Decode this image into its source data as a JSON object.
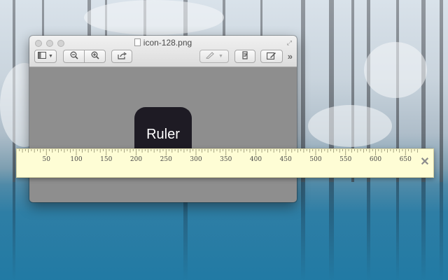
{
  "window": {
    "title": "icon-128.png"
  },
  "toolbar": {
    "icons": [
      "sidebar-view-icon",
      "chevron-down-icon",
      "zoom-out-icon",
      "zoom-in-icon",
      "share-icon",
      "markup-pen-icon",
      "rotate-icon",
      "edit-icon",
      "more-icon"
    ]
  },
  "content": {
    "icon_label": "Ruler"
  },
  "ruler": {
    "ticks": [
      50,
      100,
      150,
      200,
      250,
      300,
      350,
      400,
      450,
      500,
      550,
      600,
      650
    ],
    "close_label": "✕"
  },
  "colors": {
    "ruler_bg": "#fefdd5",
    "icon_bg": "#1e1b24",
    "window_content_bg": "#8e8e8e"
  }
}
